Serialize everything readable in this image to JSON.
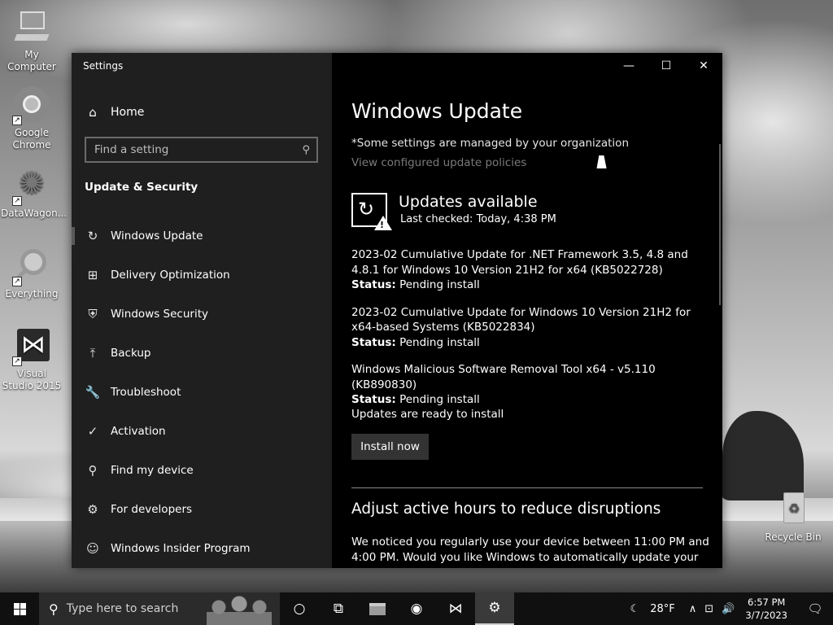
{
  "desktop": {
    "icons": [
      {
        "label": "My Computer",
        "glyph": "🖥"
      },
      {
        "label": "Google Chrome",
        "glyph": "◉"
      },
      {
        "label": "DataWagon...",
        "glyph": "✺"
      },
      {
        "label": "Everything",
        "glyph": "⚲"
      },
      {
        "label": "Visual Studio 2015",
        "glyph": "⋈"
      }
    ],
    "recycle_bin": {
      "label": "Recycle Bin",
      "glyph": "♻"
    }
  },
  "window": {
    "title": "Settings",
    "controls": {
      "minimize": "—",
      "maximize": "☐",
      "close": "✕"
    }
  },
  "nav": {
    "home": {
      "label": "Home",
      "icon": "home-icon",
      "glyph": "⌂"
    },
    "search": {
      "placeholder": "Find a setting",
      "glyph": "⚲"
    },
    "section_title": "Update & Security",
    "items": [
      {
        "label": "Windows Update",
        "icon": "sync-icon",
        "glyph": "↻",
        "active": true
      },
      {
        "label": "Delivery Optimization",
        "icon": "delivery-icon",
        "glyph": "⊞"
      },
      {
        "label": "Windows Security",
        "icon": "shield-icon",
        "glyph": "⛨"
      },
      {
        "label": "Backup",
        "icon": "backup-icon",
        "glyph": "⤒"
      },
      {
        "label": "Troubleshoot",
        "icon": "wrench-icon",
        "glyph": "🔧"
      },
      {
        "label": "Activation",
        "icon": "check-circle-icon",
        "glyph": "✓"
      },
      {
        "label": "Find my device",
        "icon": "person-icon",
        "glyph": "⚲"
      },
      {
        "label": "For developers",
        "icon": "developer-icon",
        "glyph": "⚙"
      },
      {
        "label": "Windows Insider Program",
        "icon": "insider-icon",
        "glyph": "☺"
      }
    ]
  },
  "main": {
    "title": "Windows Update",
    "managed_note": "*Some settings are managed by your organization",
    "policy_link": "View configured update policies",
    "status": {
      "title": "Updates available",
      "last_checked": "Last checked: Today, 4:38 PM"
    },
    "updates": [
      {
        "name": "2023-02 Cumulative Update for .NET Framework 3.5, 4.8 and 4.8.1 for Windows 10 Version 21H2 for x64 (KB5022728)",
        "status_label": "Status:",
        "status_value": "Pending install"
      },
      {
        "name": "2023-02 Cumulative Update for Windows 10 Version 21H2 for x64-based Systems (KB5022834)",
        "status_label": "Status:",
        "status_value": "Pending install"
      },
      {
        "name": "Windows Malicious Software Removal Tool x64 - v5.110 (KB890830)",
        "status_label": "Status:",
        "status_value": "Pending install"
      }
    ],
    "ready_text": "Updates are ready to install",
    "install_button": "Install now",
    "active_hours": {
      "title": "Adjust active hours to reduce disruptions",
      "description": "We noticed you regularly use your device between 11:00 PM and 4:00 PM. Would you like Windows to automatically update your active"
    }
  },
  "taskbar": {
    "search_placeholder": "Type here to search",
    "apps": [
      {
        "name": "cortana-icon",
        "glyph": "○"
      },
      {
        "name": "task-view-icon",
        "glyph": "⧉"
      },
      {
        "name": "file-explorer-icon",
        "glyph": "▬"
      },
      {
        "name": "chrome-icon",
        "glyph": "◉"
      },
      {
        "name": "visual-studio-icon",
        "glyph": "⋈"
      },
      {
        "name": "settings-icon",
        "glyph": "⚙",
        "active": true
      }
    ],
    "weather": "28°F",
    "weather_glyph": "☾",
    "tray_glyphs": {
      "chevron": "∧",
      "network": "⊡",
      "volume": "🔊"
    },
    "time": "6:57 PM",
    "date": "3/7/2023",
    "notifications_glyph": "🗨"
  }
}
